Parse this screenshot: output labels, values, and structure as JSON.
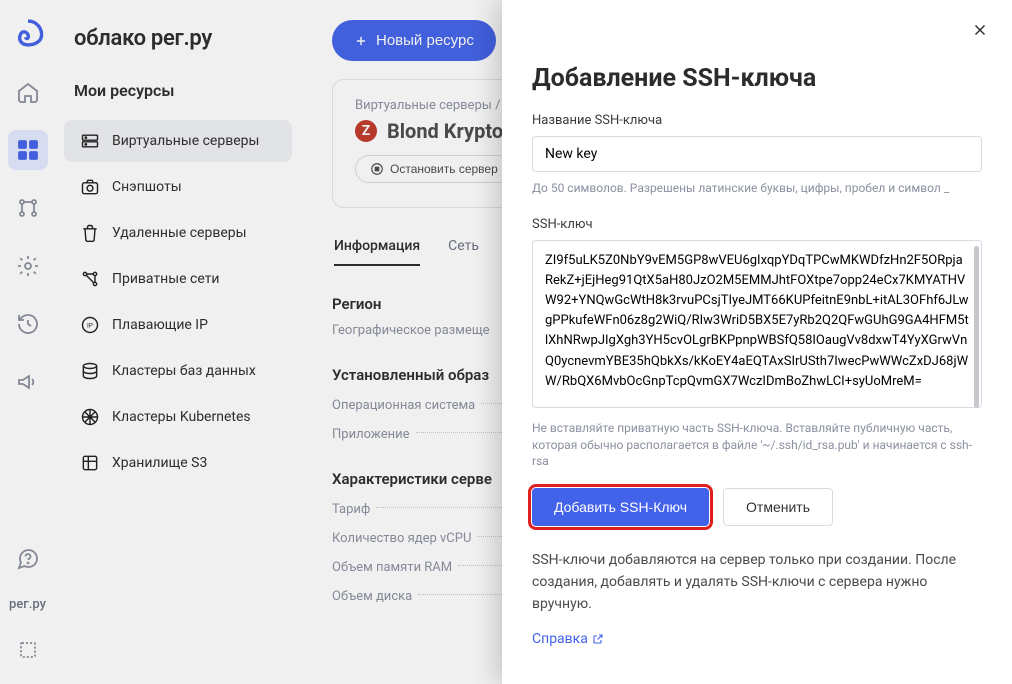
{
  "rail": {
    "brand": "рег.ру"
  },
  "sidebar": {
    "brand": "облако рег.ру",
    "section_title": "Мои ресурсы",
    "items": [
      {
        "label": "Виртуальные серверы"
      },
      {
        "label": "Снэпшоты"
      },
      {
        "label": "Удаленные серверы"
      },
      {
        "label": "Приватные сети"
      },
      {
        "label": "Плавающие IP"
      },
      {
        "label": "Кластеры баз данных"
      },
      {
        "label": "Кластеры Kubernetes"
      },
      {
        "label": "Хранилище S3"
      }
    ]
  },
  "main": {
    "new_resource": "Новый ресурс",
    "breadcrumb": "Виртуальные серверы / Bl",
    "vm_title": "Blond Krypto",
    "stop_server": "Остановить сервер",
    "tabs": [
      {
        "label": "Информация"
      },
      {
        "label": "Сеть"
      }
    ],
    "region_h": "Регион",
    "region_sub": "Географическое размеще",
    "image_h": "Установленный образ",
    "os_label": "Операционная система",
    "app_label": "Приложение",
    "specs_h": "Характеристики серве",
    "tariff_label": "Тариф",
    "vcpu_label": "Количество ядер vCPU",
    "ram_label": "Объем памяти RAM",
    "disk_label": "Объем диска"
  },
  "drawer": {
    "title": "Добавление SSH-ключа",
    "name_label": "Название SSH-ключа",
    "name_value": "New key",
    "name_helper": "До 50 символов. Разрешены латинские буквы, цифры, пробел и символ _",
    "key_label": "SSH-ключ",
    "key_value": "ZI9f5uLK5Z0NbY9vEM5GP8wVEU6gIxqpYDqTPCwMKWDfzHn2F5ORpjaRekZ+jEjHeg91QtX5aH80JzO2M5EMMJhtFOXtpe7opp24eCx7KMYATHVW92+YNQwGcWtH8k3rvuPCsjTIyeJMT66KUPfeitnE9nbL+itAL3OFhf6JLwgPPkufeWFn06z8g2WiQ/RIw3WriD5BX5E7yRb2Q2QFwGUhG9GA4HFM5tlXhNRwpJIgXgh3YH5cvOLgrBKPpnpWBSfQ58IOaugVv8dxwT4YyXGrwVnQ0ycnevmYBE35hQbkXs/kKoEY4aEQTAxSIrUSth7IwecPwWWcZxDJ68jWW/RbQX6MvbOcGnpTcpQvmGX7WczIDmBoZhwLCI+syUoMreM=",
    "key_helper": "Не вставляйте приватную часть SSH-ключа. Вставляйте публичную часть, которая обычно располагается в файле '~/.ssh/id_rsa.pub' и начинается с ssh-rsa",
    "submit": "Добавить SSH-Ключ",
    "cancel": "Отменить",
    "note": "SSH-ключи добавляются на сервер только при создании. После создания, добавлять и удалять SSH-ключи с сервера нужно вручную.",
    "help_link": "Справка"
  }
}
